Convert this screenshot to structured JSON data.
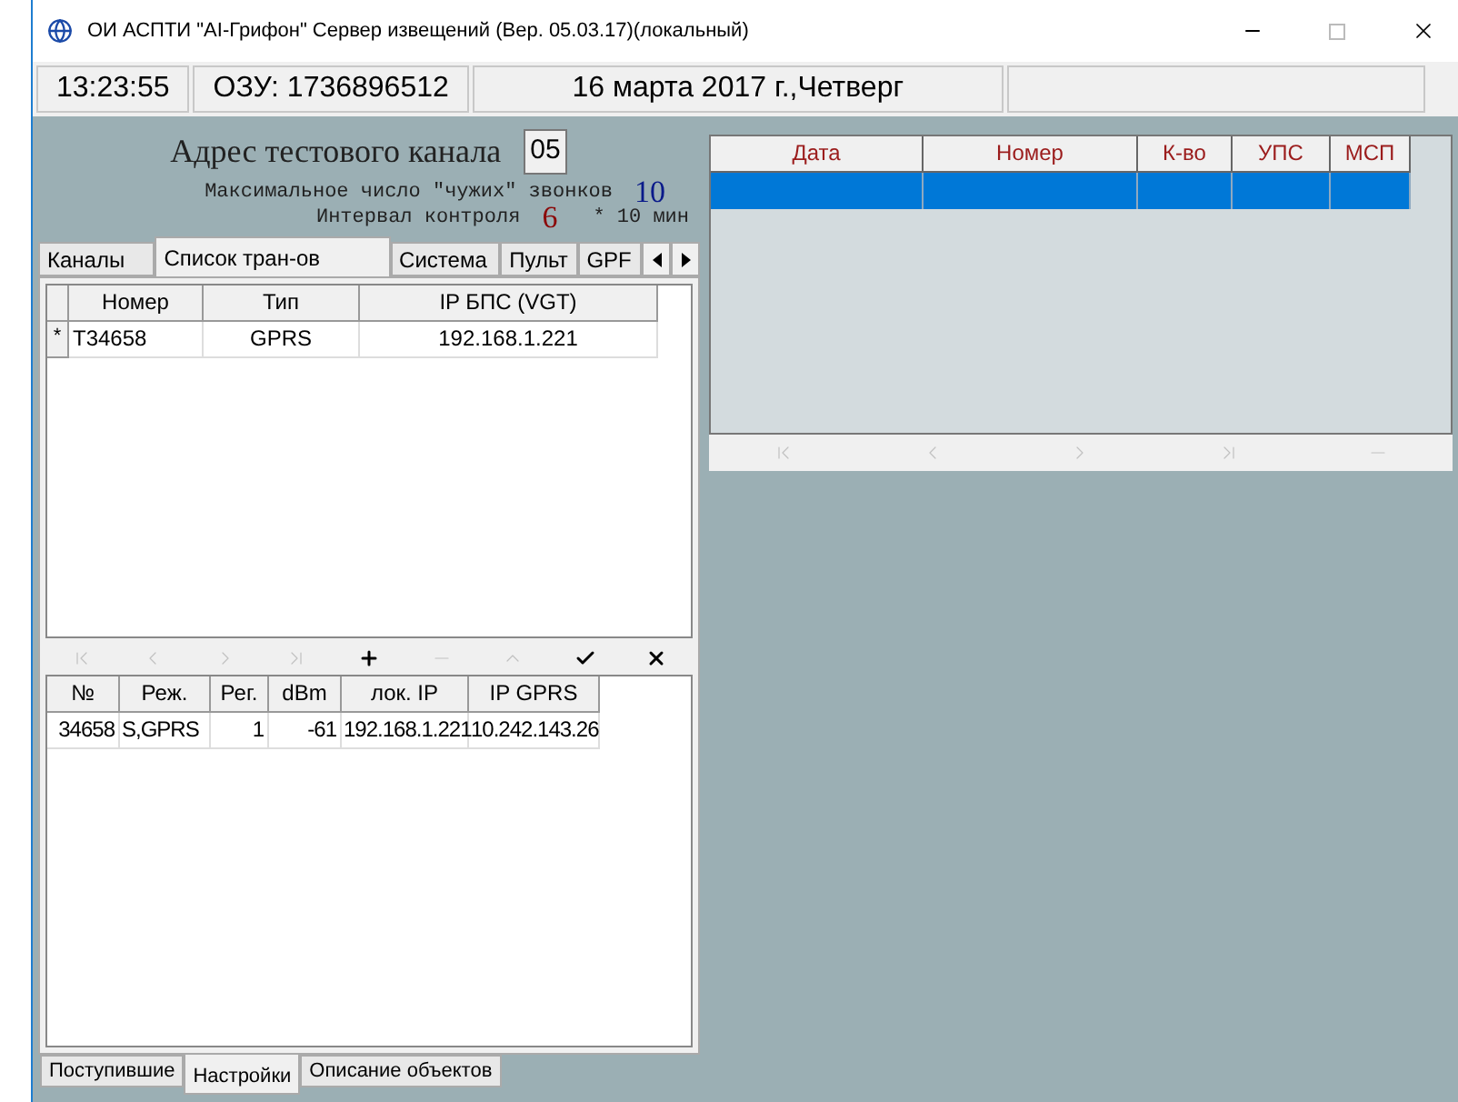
{
  "window": {
    "title": "ОИ АСПТИ \"AI-Грифон\" Сервер извещений (Вер. 05.03.17)(локальный)"
  },
  "status_bar": [
    "13:23:55",
    "ОЗУ: 1736896512",
    "16 марта 2017 г.,Четверг"
  ],
  "settings": {
    "test_channel_label": "Адрес тестового канала",
    "test_channel_value": "05",
    "max_calls_label": "Максимальное число \"чужих\" звонков",
    "max_calls_value": "10",
    "interval_label": "Интервал контроля",
    "interval_value": "6",
    "interval_unit": "* 10 мин"
  },
  "tabs": [
    {
      "label": "Каналы",
      "selected": false
    },
    {
      "label": "Список тран-ов",
      "selected": true
    },
    {
      "label": "Система",
      "selected": false
    },
    {
      "label": "Пульт",
      "selected": false
    },
    {
      "label": "GPF",
      "selected": false
    }
  ],
  "transmitters": {
    "columns": [
      "Номер",
      "Тип",
      "IP БПС (VGT)"
    ],
    "rows": [
      {
        "marker": "*",
        "cells": [
          "T34658",
          "GPRS",
          "192.168.1.221"
        ]
      }
    ]
  },
  "navigator": [
    {
      "kind": "first",
      "disabled": true
    },
    {
      "kind": "prev",
      "disabled": true
    },
    {
      "kind": "next",
      "disabled": true
    },
    {
      "kind": "last",
      "disabled": true
    },
    {
      "kind": "insert",
      "disabled": false
    },
    {
      "kind": "delete",
      "disabled": true
    },
    {
      "kind": "edit",
      "disabled": true
    },
    {
      "kind": "post",
      "disabled": false
    },
    {
      "kind": "cancel",
      "disabled": false
    }
  ],
  "details": {
    "columns": [
      "№",
      "Реж.",
      "Рег.",
      "dBm",
      "лок. IP",
      "IP GPRS"
    ],
    "rows": [
      [
        "34658",
        "S,GPRS",
        "1",
        "-61",
        "192.168.1.221",
        "10.242.143.26"
      ]
    ]
  },
  "events": {
    "columns": [
      "Дата",
      "Номер",
      "К-во",
      "УПС",
      "МСП"
    ],
    "rows": [
      {
        "selected": true,
        "cells": []
      }
    ]
  },
  "events_navigator": [
    {
      "kind": "first",
      "disabled": true
    },
    {
      "kind": "prev",
      "disabled": true
    },
    {
      "kind": "next",
      "disabled": true
    },
    {
      "kind": "last",
      "disabled": true
    },
    {
      "kind": "delete",
      "disabled": true
    }
  ],
  "bottom_tabs": [
    {
      "label": "Поступившие",
      "selected": false
    },
    {
      "label": "Настройки",
      "selected": true
    },
    {
      "label": "Описание объектов",
      "selected": false
    }
  ]
}
